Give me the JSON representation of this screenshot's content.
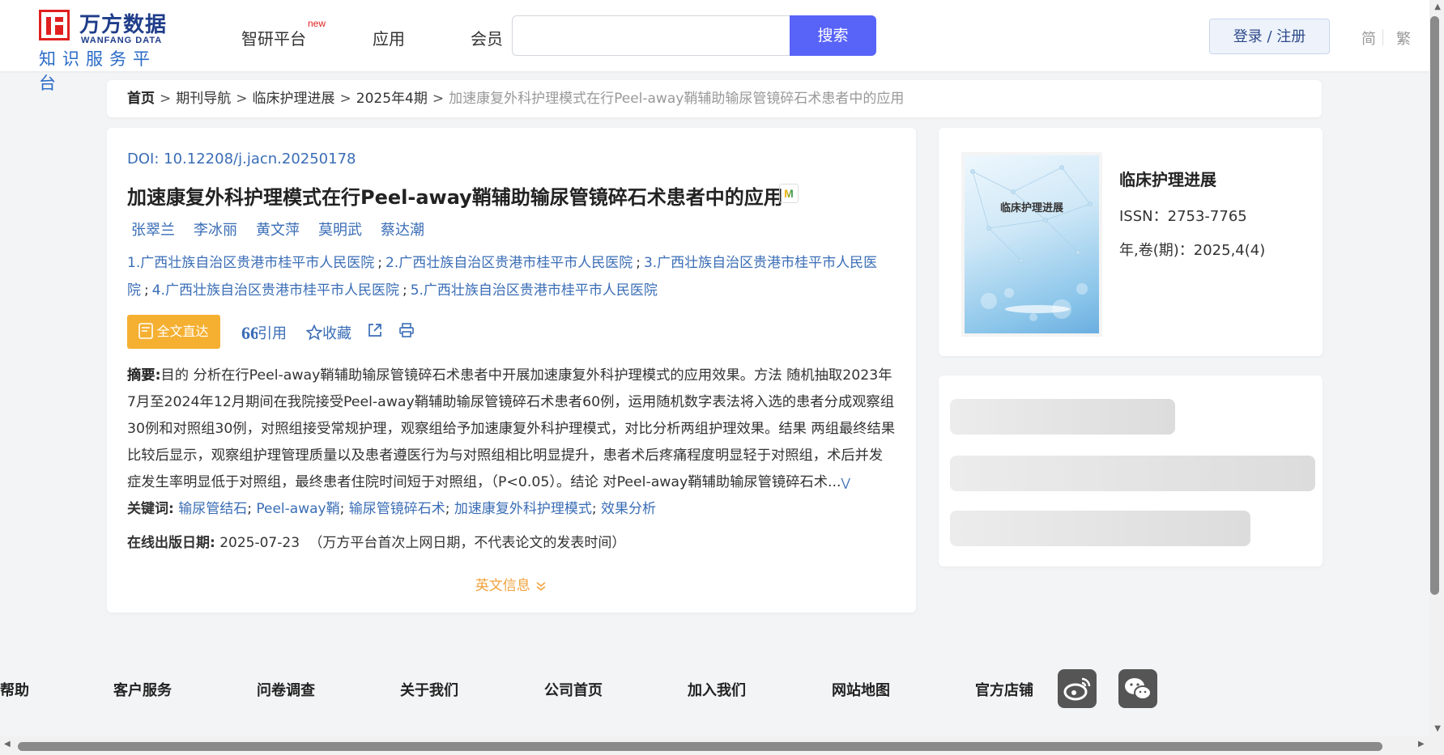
{
  "header": {
    "logo_cn": "万方数据",
    "logo_en": "WANFANG DATA",
    "logo_sub": "知识服务平台",
    "nav": [
      "智研平台",
      "应用",
      "会员"
    ],
    "nav_badge": "new",
    "search_placeholder": "",
    "search_button": "搜索",
    "login_button": "登录 / 注册",
    "lang_simplified": "简",
    "lang_traditional": "繁"
  },
  "breadcrumb": {
    "items": [
      "首页",
      "期刊导航",
      "临床护理进展",
      "2025年4期"
    ],
    "current": "加速康复外科护理模式在行Peel-away鞘辅助输尿管镜碎石术患者中的应用",
    "separator": ">"
  },
  "article": {
    "doi_label": "DOI:",
    "doi": "10.12208/j.jacn.20250178",
    "title": "加速康复外科护理模式在行Peel-away鞘辅助输尿管镜碎石术患者中的应用",
    "authors": [
      "张翠兰",
      "李冰丽",
      "黄文萍",
      "莫明武",
      "蔡达潮"
    ],
    "affiliations": [
      "1.广西壮族自治区贵港市桂平市人民医院",
      "2.广西壮族自治区贵港市桂平市人民医院",
      "3.广西壮族自治区贵港市桂平市人民医院",
      "4.广西壮族自治区贵港市桂平市人民医院",
      "5.广西壮族自治区贵港市桂平市人民医院"
    ],
    "fulltext_button": "全文直达",
    "cite_label": "引用",
    "favorite_label": "收藏",
    "abstract_label": "摘要:",
    "abstract": "目的 分析在行Peel-away鞘辅助输尿管镜碎石术患者中开展加速康复外科护理模式的应用效果。方法 随机抽取2023年7月至2024年12月期间在我院接受Peel-away鞘辅助输尿管镜碎石术患者60例，运用随机数字表法将入选的患者分成观察组30例和对照组30例，对照组接受常规护理，观察组给予加速康复外科护理模式，对比分析两组护理效果。结果 两组最终结果比较后显示，观察组护理管理质量以及患者遵医行为与对照组相比明显提升，患者术后疼痛程度明显轻于对照组，术后并发症发生率明显低于对照组，最终患者住院时间短于对照组，（P<0.05）。结论 对Peel-away鞘辅助输尿管镜碎石术...",
    "keywords_label": "关键词:",
    "keywords": [
      "输尿管结石",
      "Peel-away鞘",
      "输尿管镜碎石术",
      "加速康复外科护理模式",
      "效果分析"
    ],
    "pubdate_label": "在线出版日期:",
    "pubdate": "2025-07-23",
    "pubdate_note": "（万方平台首次上网日期，不代表论文的发表时间）",
    "english_info": "英文信息"
  },
  "journal": {
    "cover_title": "临床护理进展",
    "name": "临床护理进展",
    "issn": "ISSN：2753-7765",
    "volume": "年,卷(期)：2025,4(4)"
  },
  "footer": {
    "links": [
      "帮助",
      "客户服务",
      "问卷调查",
      "关于我们",
      "公司首页",
      "加入我们",
      "网站地图",
      "官方店铺"
    ],
    "social": [
      "weibo-icon",
      "wechat-icon"
    ]
  },
  "colors": {
    "accent": "#5863f8",
    "link": "#3a6db6",
    "fulltext": "#f5b032",
    "logo_red": "#e02020",
    "logo_blue": "#1f3d8a"
  }
}
